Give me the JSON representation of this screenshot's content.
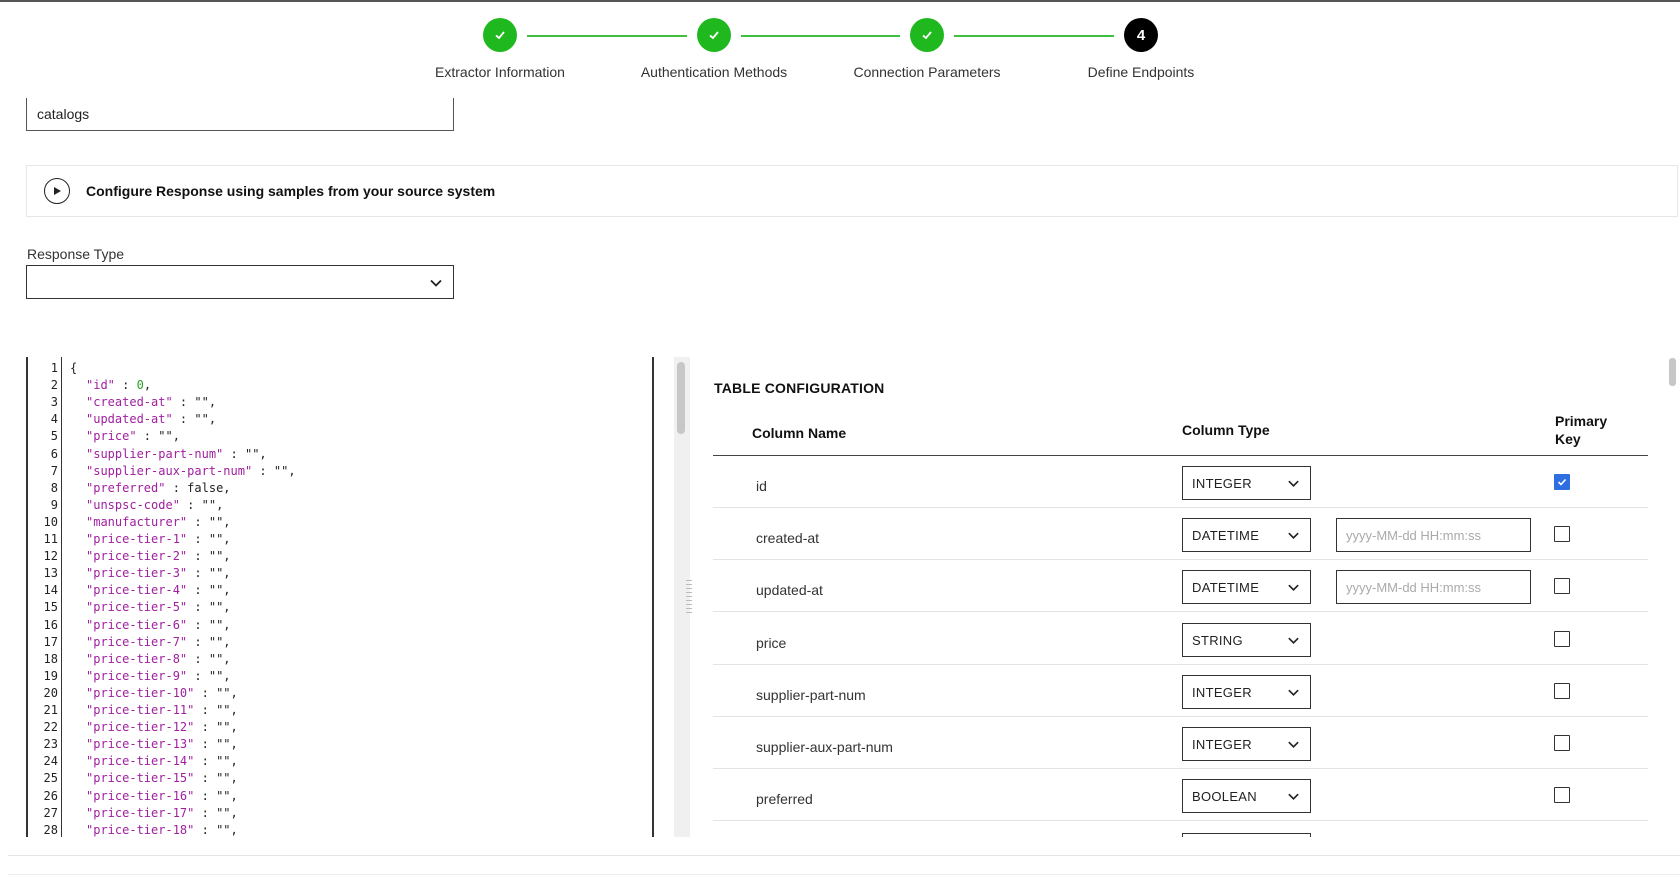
{
  "stepper": {
    "steps": [
      {
        "label": "Extractor Information",
        "state": "done"
      },
      {
        "label": "Authentication Methods",
        "state": "done"
      },
      {
        "label": "Connection Parameters",
        "state": "done"
      },
      {
        "label": "Define Endpoints",
        "state": "active",
        "number": "4"
      }
    ],
    "done_color": "#1fb81f",
    "active_color": "#000000"
  },
  "endpoint": {
    "value": "catalogs"
  },
  "configure_response": {
    "label": "Configure Response using samples from your source system",
    "icon": "play-circle-icon"
  },
  "response_type": {
    "label": "Response Type",
    "value": ""
  },
  "editor": {
    "lines": [
      {
        "no": "1",
        "text": "{"
      },
      {
        "no": "2",
        "key": "\"id\"",
        "sep": " : ",
        "val": "0",
        "valType": "num",
        "tail": ","
      },
      {
        "no": "3",
        "key": "\"created-at\"",
        "sep": " : ",
        "val": "\"\"",
        "tail": ","
      },
      {
        "no": "4",
        "key": "\"updated-at\"",
        "sep": " : ",
        "val": "\"\"",
        "tail": ","
      },
      {
        "no": "5",
        "key": "\"price\"",
        "sep": " : ",
        "val": "\"\"",
        "tail": ","
      },
      {
        "no": "6",
        "key": "\"supplier-part-num\"",
        "sep": " : ",
        "val": "\"\"",
        "tail": ","
      },
      {
        "no": "7",
        "key": "\"supplier-aux-part-num\"",
        "sep": " : ",
        "val": "\"\"",
        "tail": ","
      },
      {
        "no": "8",
        "key": "\"preferred\"",
        "sep": " : ",
        "val": "false",
        "tail": ","
      },
      {
        "no": "9",
        "key": "\"unspsc-code\"",
        "sep": " : ",
        "val": "\"\"",
        "tail": ","
      },
      {
        "no": "10",
        "key": "\"manufacturer\"",
        "sep": " : ",
        "val": "\"\"",
        "tail": ","
      },
      {
        "no": "11",
        "key": "\"price-tier-1\"",
        "sep": " : ",
        "val": "\"\"",
        "tail": ","
      },
      {
        "no": "12",
        "key": "\"price-tier-2\"",
        "sep": " : ",
        "val": "\"\"",
        "tail": ","
      },
      {
        "no": "13",
        "key": "\"price-tier-3\"",
        "sep": " : ",
        "val": "\"\"",
        "tail": ","
      },
      {
        "no": "14",
        "key": "\"price-tier-4\"",
        "sep": " : ",
        "val": "\"\"",
        "tail": ","
      },
      {
        "no": "15",
        "key": "\"price-tier-5\"",
        "sep": " : ",
        "val": "\"\"",
        "tail": ","
      },
      {
        "no": "16",
        "key": "\"price-tier-6\"",
        "sep": " : ",
        "val": "\"\"",
        "tail": ","
      },
      {
        "no": "17",
        "key": "\"price-tier-7\"",
        "sep": " : ",
        "val": "\"\"",
        "tail": ","
      },
      {
        "no": "18",
        "key": "\"price-tier-8\"",
        "sep": " : ",
        "val": "\"\"",
        "tail": ","
      },
      {
        "no": "19",
        "key": "\"price-tier-9\"",
        "sep": " : ",
        "val": "\"\"",
        "tail": ","
      },
      {
        "no": "20",
        "key": "\"price-tier-10\"",
        "sep": " : ",
        "val": "\"\"",
        "tail": ","
      },
      {
        "no": "21",
        "key": "\"price-tier-11\"",
        "sep": " : ",
        "val": "\"\"",
        "tail": ","
      },
      {
        "no": "22",
        "key": "\"price-tier-12\"",
        "sep": " : ",
        "val": "\"\"",
        "tail": ","
      },
      {
        "no": "23",
        "key": "\"price-tier-13\"",
        "sep": " : ",
        "val": "\"\"",
        "tail": ","
      },
      {
        "no": "24",
        "key": "\"price-tier-14\"",
        "sep": " : ",
        "val": "\"\"",
        "tail": ","
      },
      {
        "no": "25",
        "key": "\"price-tier-15\"",
        "sep": " : ",
        "val": "\"\"",
        "tail": ","
      },
      {
        "no": "26",
        "key": "\"price-tier-16\"",
        "sep": " : ",
        "val": "\"\"",
        "tail": ","
      },
      {
        "no": "27",
        "key": "\"price-tier-17\"",
        "sep": " : ",
        "val": "\"\"",
        "tail": ","
      },
      {
        "no": "28",
        "key": "\"price-tier-18\"",
        "sep": " : ",
        "val": "\"\"",
        "tail": ","
      }
    ]
  },
  "table_config": {
    "title": "TABLE CONFIGURATION",
    "headers": {
      "name": "Column Name",
      "type": "Column Type",
      "pk_line1": "Primary",
      "pk_line2": "Key"
    },
    "rows": [
      {
        "name": "id",
        "type": "INTEGER",
        "format": null,
        "pk": true
      },
      {
        "name": "created-at",
        "type": "DATETIME",
        "format": "yyyy-MM-dd HH:mm:ss",
        "pk": false
      },
      {
        "name": "updated-at",
        "type": "DATETIME",
        "format": "yyyy-MM-dd HH:mm:ss",
        "pk": false
      },
      {
        "name": "price",
        "type": "STRING",
        "format": null,
        "pk": false
      },
      {
        "name": "supplier-part-num",
        "type": "INTEGER",
        "format": null,
        "pk": false
      },
      {
        "name": "supplier-aux-part-num",
        "type": "INTEGER",
        "format": null,
        "pk": false
      },
      {
        "name": "preferred",
        "type": "BOOLEAN",
        "format": null,
        "pk": false
      }
    ],
    "checkbox_color": "#2d6fe0"
  }
}
